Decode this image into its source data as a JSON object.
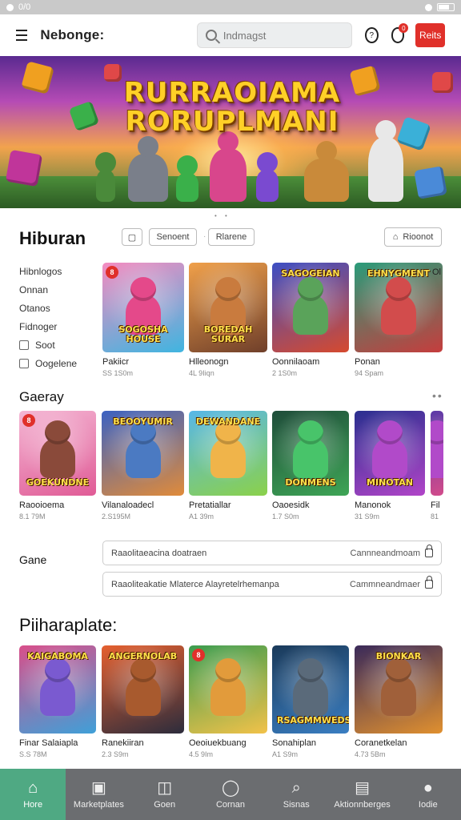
{
  "statusbar": {
    "left_text": "0/0"
  },
  "appbar": {
    "title": "Nebonge:",
    "search_placeholder": "Indmagst",
    "notif_badge": "0",
    "red_button": "Reits"
  },
  "banner": {
    "title_line1": "RURRAOIAMA",
    "title_line2": "RORUPLMANI"
  },
  "section1": {
    "title": "Hiburan",
    "chip_left": "Senoent",
    "chip_mid": "Rlarene",
    "chip_right": "Rioonot",
    "filters": [
      {
        "label": "Hibnlogos",
        "checkbox": false
      },
      {
        "label": "Onnan",
        "checkbox": false
      },
      {
        "label": "Otanos",
        "checkbox": false
      },
      {
        "label": "Fidnoger",
        "checkbox": false
      },
      {
        "label": "Soot",
        "checkbox": true
      },
      {
        "label": "Oogelene",
        "checkbox": true
      }
    ],
    "cards": [
      {
        "name": "Pakiicr",
        "sub": "SS 1S0m",
        "label": "SOGOSHA HOUSE",
        "badge": "8",
        "c1": "#f58cc0",
        "c2": "#3fb5e0",
        "hero": "#e4498a"
      },
      {
        "name": "Hlleonogn",
        "sub": "4L 9Iiqn",
        "label": "BOREDAH SURAR",
        "badge": "",
        "c1": "#f0a04a",
        "c2": "#6f3f2a",
        "hero": "#c97b3e"
      },
      {
        "name": "Oonnilaoam",
        "sub": "2 1S0m",
        "label": "SAGOGEIAN",
        "badge": "",
        "c1": "#3d4fc4",
        "c2": "#d64a2e",
        "hero": "#5aa35a"
      },
      {
        "name": "Ponan",
        "sub": "94 Spam",
        "label": "EHNYGMENT",
        "badge": "",
        "c1": "#2a9c7a",
        "c2": "#c63d3d",
        "hero": "#d24c4c"
      },
      {
        "name": "Ol",
        "sub": "",
        "label": "",
        "badge": "",
        "c1": "#888",
        "c2": "#888",
        "hero": "#888"
      }
    ]
  },
  "section2": {
    "title": "Gaeray",
    "cards": [
      {
        "name": "Raooioema",
        "sub": "8.1 79M",
        "label": "GOEKUNDNE",
        "badge": "8",
        "c1": "#f4b7d4",
        "c2": "#e05b96",
        "hero": "#8a4a3a"
      },
      {
        "name": "Vilanaloadecl",
        "sub": "2.S195M",
        "label": "BEOOYUMIR",
        "badge": "",
        "c1": "#3b62c2",
        "c2": "#e08b3a",
        "hero": "#4b7ac2"
      },
      {
        "name": "Pretatiallar",
        "sub": "A1 39m",
        "label": "DEWANDANE",
        "badge": "",
        "c1": "#58b7e8",
        "c2": "#8bd14a",
        "hero": "#f0b44a"
      },
      {
        "name": "Oaoesidk",
        "sub": "1.7 S0m",
        "label": "DONMENS",
        "badge": "",
        "c1": "#1f4d3a",
        "c2": "#3ea556",
        "hero": "#48c46a"
      },
      {
        "name": "Manonok",
        "sub": "31 S9m",
        "label": "MINOTAN",
        "badge": "",
        "c1": "#2a2f8f",
        "c2": "#b145c8",
        "hero": "#b14ac9"
      },
      {
        "name": "Fil",
        "sub": "81",
        "label": "",
        "badge": "",
        "c1": "#5b3aa8",
        "c2": "#d24b8b",
        "hero": "#b14ac9"
      }
    ]
  },
  "section3": {
    "title": "Gane",
    "rows": [
      {
        "left": "Raaolitaeacina doatraen",
        "right": "Cannneandmoam"
      },
      {
        "left": "Raaoliteakatie Mlaterce Alayretelrhemanpa",
        "right": "Cammneandmaer"
      }
    ]
  },
  "section4": {
    "title": "Piiharaplate:",
    "cards": [
      {
        "name": "Finar Salaiapla",
        "sub": "S.S 78M",
        "label": "KAIGABOMA",
        "badge": "",
        "c1": "#d94f8a",
        "c2": "#3fa0d8",
        "hero": "#7a5ad0"
      },
      {
        "name": "Ranekiiran",
        "sub": "2.3 S9m",
        "label": "ANGERNOLAB",
        "badge": "",
        "c1": "#e5602f",
        "c2": "#2c2c3c",
        "hero": "#a85a2e"
      },
      {
        "name": "Oeoiuekbuang",
        "sub": "4.5 9Im",
        "label": "",
        "badge": "8",
        "c1": "#3a9c4e",
        "c2": "#f2c24a",
        "hero": "#e29b3b"
      },
      {
        "name": "Sonahiplan",
        "sub": "A1 S9m",
        "label": "RSAGMMWEDS",
        "badge": "",
        "c1": "#1a3a5a",
        "c2": "#3a7ec2",
        "hero": "#5a6a7a"
      },
      {
        "name": "Coranetkelan",
        "sub": "4.73 5Bm",
        "label": "BIONKAR",
        "badge": "",
        "c1": "#3a2a5a",
        "c2": "#e0902f",
        "hero": "#a0603a"
      }
    ]
  },
  "bottomnav": [
    {
      "label": "Hore",
      "icon": "home-icon",
      "active": true
    },
    {
      "label": "Marketplates",
      "icon": "store-icon",
      "active": false
    },
    {
      "label": "Goen",
      "icon": "games-icon",
      "active": false
    },
    {
      "label": "Cornan",
      "icon": "chat-icon",
      "active": false
    },
    {
      "label": "Sisnas",
      "icon": "search-icon",
      "active": false
    },
    {
      "label": "Aktionnberges",
      "icon": "bag-icon",
      "active": false
    },
    {
      "label": "Iodie",
      "icon": "profile-icon",
      "active": false
    }
  ],
  "colors": {
    "accent": "#e0302a",
    "nav_active": "#4fa983",
    "nav_bg": "#6b6d70"
  }
}
